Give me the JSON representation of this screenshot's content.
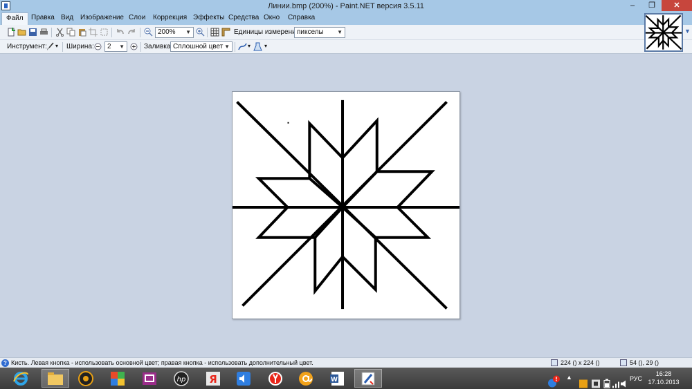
{
  "window": {
    "title": "Линии.bmp (200%) - Paint.NET версия 3.5.11",
    "min_glyph": "–",
    "max_glyph": "❐",
    "close_glyph": "✕"
  },
  "menu": {
    "items": [
      "Файл",
      "Правка",
      "Вид",
      "Изображение",
      "Слои",
      "Коррекция",
      "Эффекты",
      "Средства",
      "Окно",
      "Справка"
    ]
  },
  "toolbar": {
    "zoom_value": "200%",
    "units_label": "Единицы измерения:",
    "units_value": "пикселы"
  },
  "tool_options": {
    "tool_label": "Инструмент:",
    "width_label": "Ширина:",
    "width_value": "2",
    "fill_label": "Заливка:",
    "fill_value": "Сплошной цвет"
  },
  "status": {
    "help_glyph": "?",
    "message": "Кисть. Левая кнопка - использовать основной цвет; правая кнопка - использовать дополнительный цвет.",
    "image_size": "224 () x 224 ()",
    "cursor_pos": "54 (), 29 ()"
  },
  "taskbar": {
    "lang": "РУС",
    "time": "16:28",
    "date": "17.10.2013"
  },
  "colors": {
    "titlebar": "#a6c8e6",
    "workspace": "#c9d3e3",
    "close": "#c7463d",
    "stroke": "#000000"
  }
}
